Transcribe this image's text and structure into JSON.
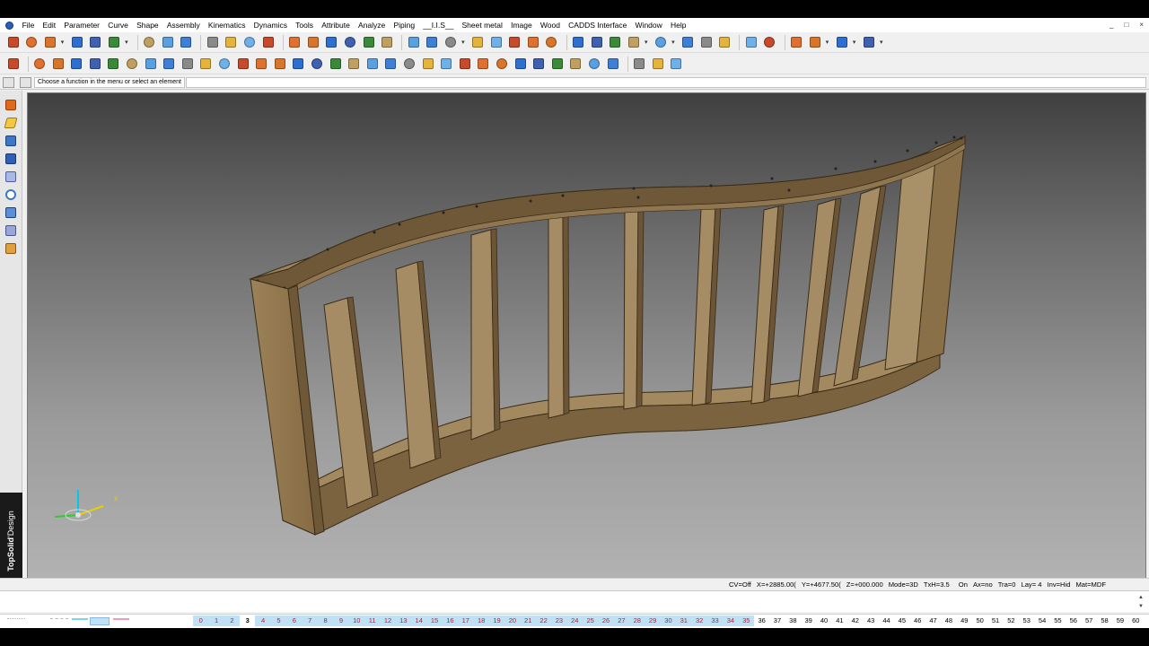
{
  "menu": [
    "File",
    "Edit",
    "Parameter",
    "Curve",
    "Shape",
    "Assembly",
    "Kinematics",
    "Dynamics",
    "Tools",
    "Attribute",
    "Analyze",
    "Piping",
    "__I.I.S__",
    "Sheet metal",
    "Image",
    "Wood",
    "CADDS Interface",
    "Window",
    "Help"
  ],
  "window_controls": [
    "_",
    "□",
    "×"
  ],
  "prompt": {
    "text": "Choose a function in the menu or select an element",
    "input_value": ""
  },
  "brand": {
    "bold": "TopSolid",
    "rest": "'Design"
  },
  "status": {
    "cv": "CV=Off",
    "x": "X=+2885.00(",
    "y": "Y=+4677.50(",
    "z": "Z=+000.000",
    "mode": "Mode=3D",
    "txh": "TxH=3.5",
    "on": "On",
    "ax": "Ax=no",
    "tra": "Tra=0",
    "lay": "Lay= 4",
    "inv": "Inv=Hid",
    "mat": "Mat=MDF"
  },
  "layers": [
    "0",
    "1",
    "2",
    "3",
    "4",
    "5",
    "6",
    "7",
    "8",
    "9",
    "10",
    "11",
    "12",
    "13",
    "14",
    "15",
    "16",
    "17",
    "18",
    "19",
    "20",
    "21",
    "22",
    "23",
    "24",
    "25",
    "26",
    "27",
    "28",
    "29",
    "30",
    "31",
    "32",
    "33",
    "34",
    "35",
    "36",
    "37",
    "38",
    "39",
    "40",
    "41",
    "42",
    "43",
    "44",
    "45",
    "46",
    "47",
    "48",
    "49",
    "50",
    "51",
    "52",
    "53",
    "54",
    "55",
    "56",
    "57",
    "58",
    "59",
    "60"
  ],
  "current_layer": "4",
  "used_layers": [
    "0",
    "1",
    "2",
    "5",
    "6",
    "7",
    "8",
    "9",
    "10",
    "11",
    "12",
    "13",
    "14",
    "15",
    "16",
    "17",
    "18",
    "19",
    "20",
    "21",
    "22",
    "23",
    "24",
    "25",
    "26",
    "27",
    "28",
    "29",
    "30",
    "31",
    "32",
    "33",
    "34",
    "35"
  ],
  "colors": {
    "mdf": "#8a7148",
    "mdf_light": "#a68c63",
    "mdf_dark": "#6b5536",
    "accent_red": "#c0182e",
    "layer_bg": "#bfe0f5",
    "brand_bg": "#1a1a1a"
  },
  "toolbar_icons": {
    "row1": [
      "new-icon",
      "open-icon",
      "save-icon",
      "print-preview-icon",
      "copy-icon",
      "print-icon",
      "undo-icon",
      "erase-icon",
      "view-icon",
      "zoom-icon",
      "pencil-icon",
      "adjust-icon",
      "measure-icon",
      "link-icon",
      "paint-icon",
      "cut-icon",
      "magnet-icon",
      "curve-tool-icon",
      "scissors-icon",
      "hook-icon",
      "shape-icon",
      "dimension-icon",
      "frame-icon",
      "picture-icon",
      "image-icon",
      "layer-icon",
      "lock-icon",
      "screen-icon",
      "render-icon",
      "window-icon",
      "light-icon",
      "shade-icon",
      "display-icon",
      "section-icon",
      "ortho-icon",
      "clip-icon",
      "wireframe-icon",
      "alert-icon",
      "line-style-icon",
      "line-width-icon",
      "hatch-icon"
    ],
    "row2": [
      "wood-part-icon",
      "circle-icon",
      "find-icon",
      "grid-icon",
      "block-icon",
      "box-icon",
      "panel-icon",
      "drawer-icon",
      "shelf-icon",
      "frame-part-icon",
      "board-icon",
      "edge-icon",
      "joint-icon",
      "dowel-icon",
      "tenon-icon",
      "plank-icon",
      "stack-icon",
      "cube-icon",
      "machining-icon",
      "pocket-icon",
      "bevel-icon",
      "chamfer-icon",
      "bend-icon",
      "slope-icon",
      "blade-icon",
      "folder-icon",
      "info-icon",
      "sheet-icon",
      "tube-icon",
      "connect-icon",
      "rail-icon",
      "saw-icon",
      "drill-icon",
      "arrow-icon",
      "star-icon",
      "stretch-icon"
    ]
  }
}
